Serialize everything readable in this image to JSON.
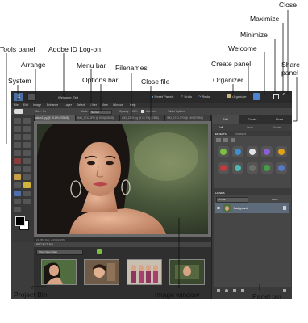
{
  "callouts": {
    "close": "Close",
    "maximize": "Maximize",
    "minimize": "Minimize",
    "welcome": "Welcome",
    "create_panel": "Create panel",
    "organizer": "Organizer",
    "share_panel": "Share\npanel",
    "tools_panel": "Tools panel",
    "arrange": "Arrange",
    "adobe_id": "Adobe ID Log-on",
    "menu_bar": "Menu bar",
    "filenames": "Filenames",
    "options_bar": "Options bar",
    "system": "System",
    "close_file": "Close file",
    "project_bin": "Project Bin",
    "image_window": "Image window",
    "panel_bin": "Panel bin"
  },
  "app": {
    "logo": "E",
    "title": "Welcome, Ted",
    "reset_panels": "Reset Panels",
    "undo": "Undo",
    "redo": "Redo",
    "organizer": "Organizer",
    "menu": [
      "File",
      "Edit",
      "Image",
      "Enhance",
      "Layer",
      "Select",
      "Filter",
      "View",
      "Window",
      "Help"
    ],
    "options": {
      "size_label": "Size:",
      "size_value": "Px",
      "mode_label": "Mode:",
      "mode_value": "Normal",
      "opacity_label": "Opacity:",
      "opacity_value": "100%",
      "airbrush": "Airbrush",
      "tablet": "Tablet Options"
    },
    "file_tabs": [
      "asian1.jpg @ 76.8% (RGB/8)",
      "IMG_0712.JPG @ 50%(RGB/8)",
      "IMG_2389.jpg @ 16.7%(RGB/8)",
      "IMG_0712.JPG @ 16%(RGB/8)"
    ],
    "status": "21.88%   Doc: 2.25M/2.25M",
    "project_bin_title": "PROJECT BIN",
    "project_bin_filter": "Show Open Files",
    "panel_tabs": [
      "Edit",
      "Create",
      "Share"
    ],
    "edit_subtabs": [
      "Full",
      "Quick",
      "Guided"
    ],
    "effects_title": "EFFECTS",
    "content_title": "CONTENT",
    "layers_title": "LAYERS",
    "layers_blend": "Normal",
    "layers_opacity": "100%",
    "layer_name": "Background",
    "fx_colors": [
      "#7bc043",
      "#3f8ed1",
      "#e3e3e3",
      "#8a5fd3",
      "#e0a21a",
      "#c43b3b",
      "#50b8b0",
      "#6d6d6d",
      "#3fa142",
      "#5977c4"
    ]
  }
}
